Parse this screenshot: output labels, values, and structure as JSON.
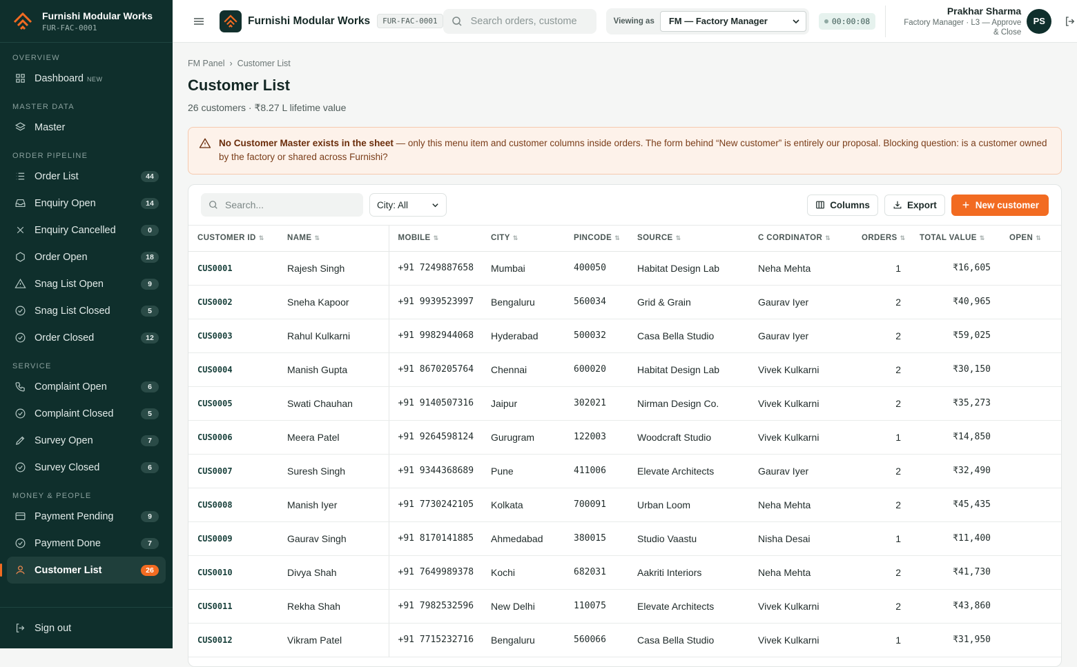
{
  "brand": {
    "name": "Furnishi Modular Works",
    "code": "FUR-FAC-0001"
  },
  "sidebar": {
    "sections": [
      {
        "label": "OVERVIEW",
        "items": [
          {
            "label": "Dashboard",
            "icon": "grid-icon",
            "tag": "NEW",
            "count": null
          }
        ]
      },
      {
        "label": "MASTER DATA",
        "items": [
          {
            "label": "Master",
            "icon": "layers-icon",
            "count": null
          }
        ]
      },
      {
        "label": "ORDER PIPELINE",
        "items": [
          {
            "label": "Order List",
            "icon": "list-icon",
            "count": "44"
          },
          {
            "label": "Enquiry Open",
            "icon": "inbox-icon",
            "count": "14"
          },
          {
            "label": "Enquiry Cancelled",
            "icon": "x-icon",
            "count": "0"
          },
          {
            "label": "Order Open",
            "icon": "hexagon-icon",
            "count": "18"
          },
          {
            "label": "Snag List Open",
            "icon": "warning-icon",
            "count": "9"
          },
          {
            "label": "Snag List Closed",
            "icon": "check-circle-icon",
            "count": "5"
          },
          {
            "label": "Order Closed",
            "icon": "check-circle-icon",
            "count": "12"
          }
        ]
      },
      {
        "label": "SERVICE",
        "items": [
          {
            "label": "Complaint Open",
            "icon": "phone-icon",
            "count": "6"
          },
          {
            "label": "Complaint Closed",
            "icon": "check-circle-icon",
            "count": "5"
          },
          {
            "label": "Survey Open",
            "icon": "pencil-icon",
            "count": "7"
          },
          {
            "label": "Survey Closed",
            "icon": "check-circle-icon",
            "count": "6"
          }
        ]
      },
      {
        "label": "MONEY & PEOPLE",
        "items": [
          {
            "label": "Payment Pending",
            "icon": "wallet-icon",
            "count": "9"
          },
          {
            "label": "Payment Done",
            "icon": "check-circle-icon",
            "count": "7"
          },
          {
            "label": "Customer List",
            "icon": "user-icon",
            "count": "26",
            "active": true
          }
        ]
      }
    ],
    "sign_out": "Sign out"
  },
  "header": {
    "title": "Furnishi Modular Works",
    "code": "FUR-FAC-0001",
    "search_placeholder": "Search orders, custome",
    "viewing_label": "Viewing as",
    "viewing_value": "FM — Factory Manager",
    "timer": "00:00:08",
    "user_name": "Prakhar Sharma",
    "user_role_line1": "Factory Manager · L3 — Approve",
    "user_role_line2": "& Close",
    "avatar_initials": "PS"
  },
  "page": {
    "breadcrumb_parent": "FM Panel",
    "breadcrumb_current": "Customer List",
    "title": "Customer List",
    "subtitle": "26 customers · ₹8.27 L lifetime value",
    "alert_bold": "No Customer Master exists in the sheet",
    "alert_text": " — only this menu item and customer columns inside orders. The form behind “New customer” is entirely our proposal. Blocking question: is a customer owned by the factory or shared across Furnishi?"
  },
  "toolbar": {
    "search_placeholder": "Search...",
    "city_filter": "City: All",
    "columns_label": "Columns",
    "export_label": "Export",
    "new_label": "New customer"
  },
  "table": {
    "headers": [
      "CUSTOMER ID",
      "NAME",
      "MOBILE",
      "CITY",
      "PINCODE",
      "SOURCE",
      "C CORDINATOR",
      "ORDERS",
      "TOTAL VALUE",
      "OPEN"
    ],
    "rows": [
      [
        "CUS0001",
        "Rajesh Singh",
        "+91 7249887658",
        "Mumbai",
        "400050",
        "Habitat Design Lab",
        "Neha Mehta",
        "1",
        "₹16,605"
      ],
      [
        "CUS0002",
        "Sneha Kapoor",
        "+91 9939523997",
        "Bengaluru",
        "560034",
        "Grid & Grain",
        "Gaurav Iyer",
        "2",
        "₹40,965"
      ],
      [
        "CUS0003",
        "Rahul Kulkarni",
        "+91 9982944068",
        "Hyderabad",
        "500032",
        "Casa Bella Studio",
        "Gaurav Iyer",
        "2",
        "₹59,025"
      ],
      [
        "CUS0004",
        "Manish Gupta",
        "+91 8670205764",
        "Chennai",
        "600020",
        "Habitat Design Lab",
        "Vivek Kulkarni",
        "2",
        "₹30,150"
      ],
      [
        "CUS0005",
        "Swati Chauhan",
        "+91 9140507316",
        "Jaipur",
        "302021",
        "Nirman Design Co.",
        "Vivek Kulkarni",
        "2",
        "₹35,273"
      ],
      [
        "CUS0006",
        "Meera Patel",
        "+91 9264598124",
        "Gurugram",
        "122003",
        "Woodcraft Studio",
        "Vivek Kulkarni",
        "1",
        "₹14,850"
      ],
      [
        "CUS0007",
        "Suresh Singh",
        "+91 9344368689",
        "Pune",
        "411006",
        "Elevate Architects",
        "Gaurav Iyer",
        "2",
        "₹32,490"
      ],
      [
        "CUS0008",
        "Manish Iyer",
        "+91 7730242105",
        "Kolkata",
        "700091",
        "Urban Loom",
        "Neha Mehta",
        "2",
        "₹45,435"
      ],
      [
        "CUS0009",
        "Gaurav Singh",
        "+91 8170141885",
        "Ahmedabad",
        "380015",
        "Studio Vaastu",
        "Nisha Desai",
        "1",
        "₹11,400"
      ],
      [
        "CUS0010",
        "Divya Shah",
        "+91 7649989378",
        "Kochi",
        "682031",
        "Aakriti Interiors",
        "Neha Mehta",
        "2",
        "₹41,730"
      ],
      [
        "CUS0011",
        "Rekha Shah",
        "+91 7982532596",
        "New Delhi",
        "110075",
        "Elevate Architects",
        "Vivek Kulkarni",
        "2",
        "₹43,860"
      ],
      [
        "CUS0012",
        "Vikram Patel",
        "+91 7715232716",
        "Bengaluru",
        "560066",
        "Casa Bella Studio",
        "Vivek Kulkarni",
        "1",
        "₹31,950"
      ]
    ]
  },
  "colors": {
    "sidebar_bg": "#0f2f2c",
    "accent": "#f26b21",
    "alert_bg": "#fdf2ea"
  }
}
